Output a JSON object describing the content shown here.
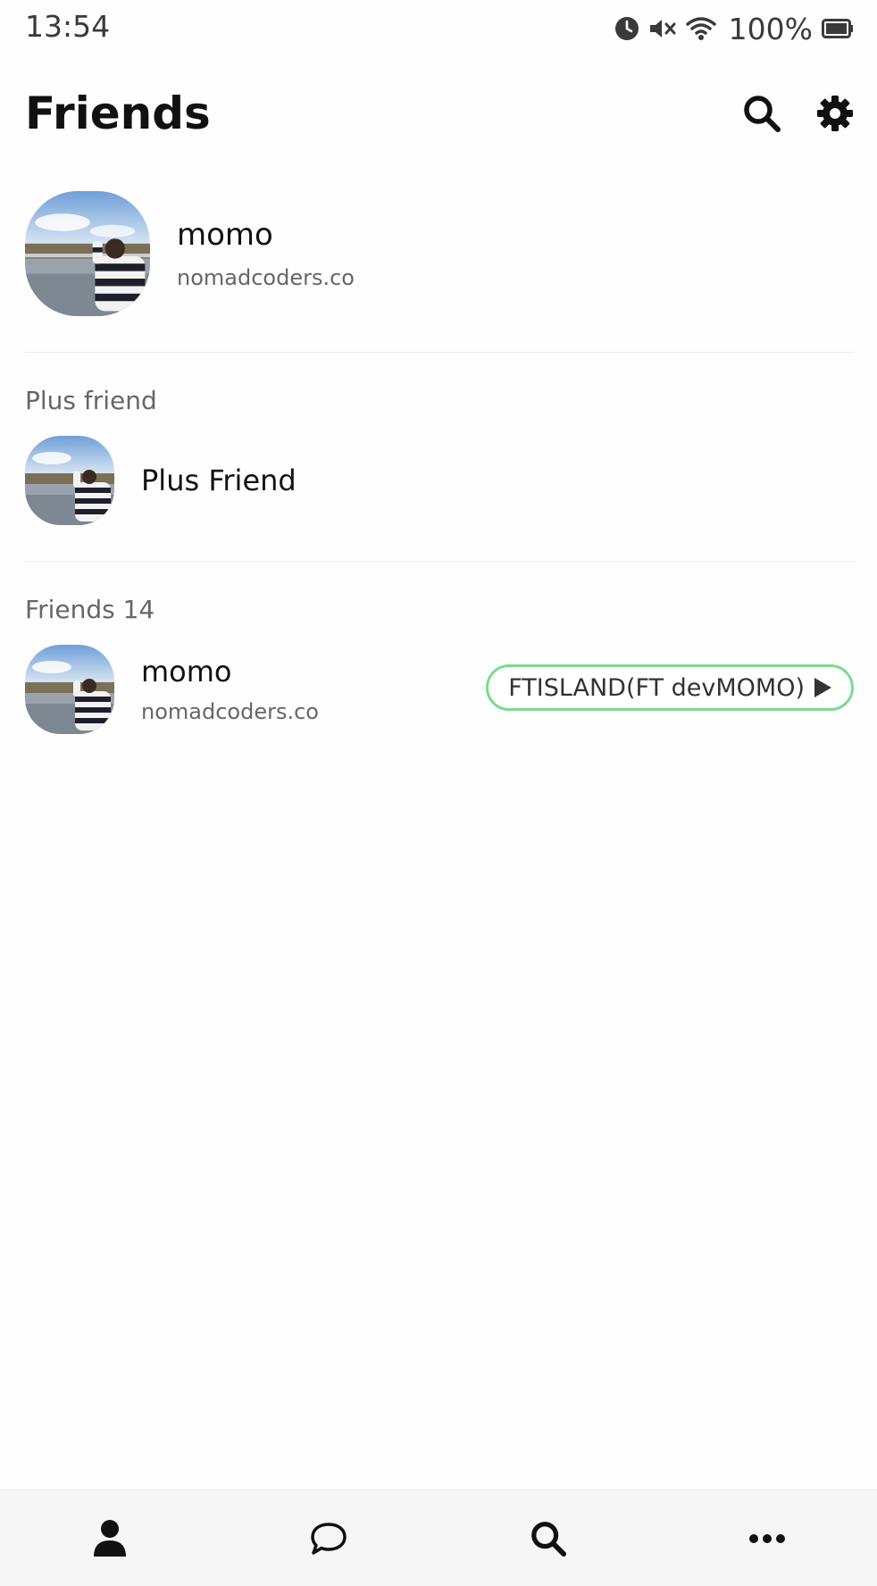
{
  "status_bar": {
    "time": "13:54",
    "battery": "100%",
    "icons": [
      "alarm-icon",
      "mute-icon",
      "wifi-icon",
      "battery-icon"
    ]
  },
  "header": {
    "title": "Friends",
    "actions": [
      "search-icon",
      "settings-gear-icon"
    ]
  },
  "my_profile": {
    "name": "momo",
    "status": "nomadcoders.co"
  },
  "plus_friend": {
    "section_label": "Plus friend",
    "item_name": "Plus Friend"
  },
  "friends": {
    "section_label": "Friends 14",
    "items": [
      {
        "name": "momo",
        "status": "nomadcoders.co",
        "music": "FTISLAND(FT devMOMO)"
      }
    ]
  },
  "bottom_nav": {
    "items": [
      "person-icon",
      "chat-bubble-icon",
      "search-icon",
      "more-dots-icon"
    ]
  },
  "colors": {
    "music_border": "#7dd98d",
    "nav_background": "#f6f6f6"
  }
}
